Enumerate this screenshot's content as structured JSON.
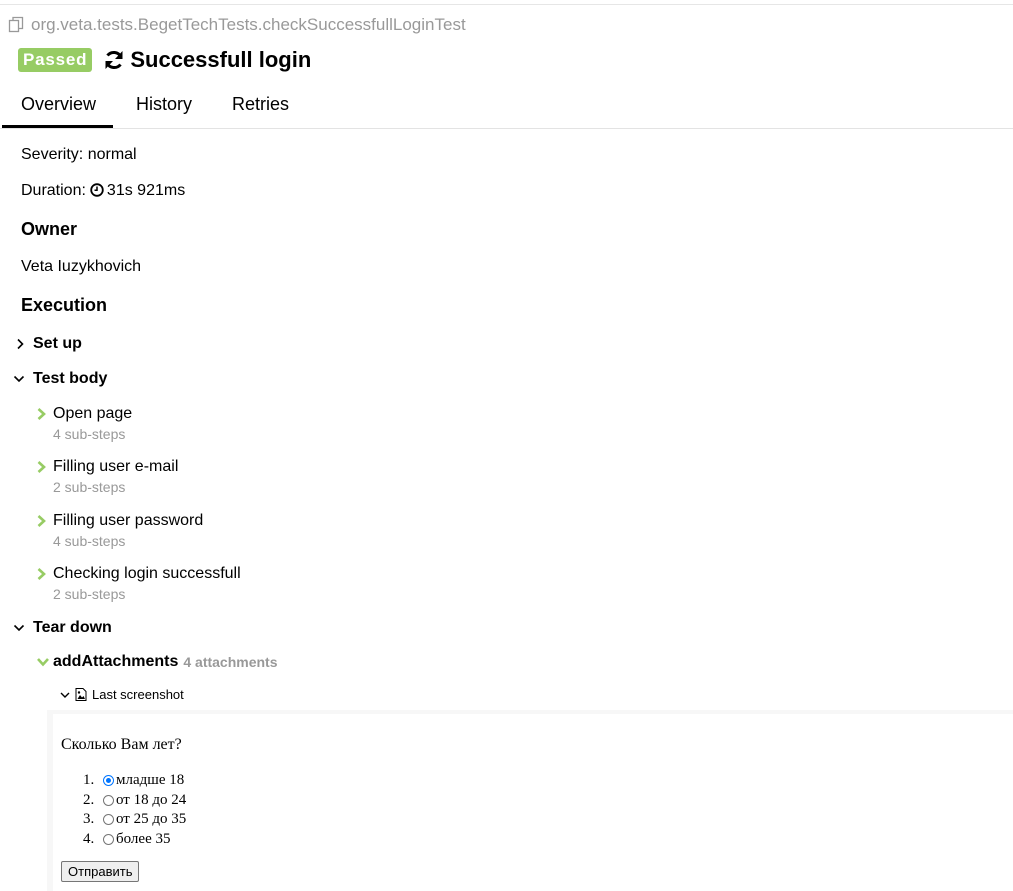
{
  "header": {
    "fullname": "org.veta.tests.BegetTechTests.checkSuccessfullLoginTest",
    "status_badge": "Passed",
    "title": "Successfull login"
  },
  "tabs": [
    {
      "label": "Overview",
      "active": true
    },
    {
      "label": "History",
      "active": false
    },
    {
      "label": "Retries",
      "active": false
    }
  ],
  "overview": {
    "severity": "Severity: normal",
    "duration_label": "Duration:",
    "duration_value": "31s 921ms",
    "owner_heading": "Owner",
    "owner_name": "Veta Iuzykhovich",
    "execution_heading": "Execution"
  },
  "execution": {
    "setup_label": "Set up",
    "test_body_label": "Test body",
    "steps": [
      {
        "title": "Open page",
        "substeps": "4 sub-steps"
      },
      {
        "title": "Filling user e-mail",
        "substeps": "2 sub-steps"
      },
      {
        "title": "Filling user password",
        "substeps": "4 sub-steps"
      },
      {
        "title": "Checking login successfull",
        "substeps": "2 sub-steps"
      }
    ],
    "teardown_label": "Tear down",
    "attachment_step": {
      "title": "addAttachments",
      "count": "4 attachments"
    },
    "attachment": {
      "name": "Last screenshot"
    }
  },
  "screenshot": {
    "question": "Сколько Вам лет?",
    "options": [
      {
        "num": "1.",
        "label": "младше 18",
        "checked": true
      },
      {
        "num": "2.",
        "label": "от 18 до 24",
        "checked": false
      },
      {
        "num": "3.",
        "label": "от 25 до 35",
        "checked": false
      },
      {
        "num": "4.",
        "label": "более 35",
        "checked": false
      }
    ],
    "submit_label": "Отправить"
  },
  "colors": {
    "passed": "#97cc64",
    "muted_text": "#999999",
    "radio_checked": "#0075ff"
  },
  "icons": {
    "fullname": "copy-icon",
    "retry": "retry-icon",
    "duration": "clock-icon",
    "collapsed": "chevron-right-icon",
    "expanded": "chevron-down-icon",
    "step_passed": "green-chevron-right-icon",
    "attachment": "image-file-icon"
  }
}
